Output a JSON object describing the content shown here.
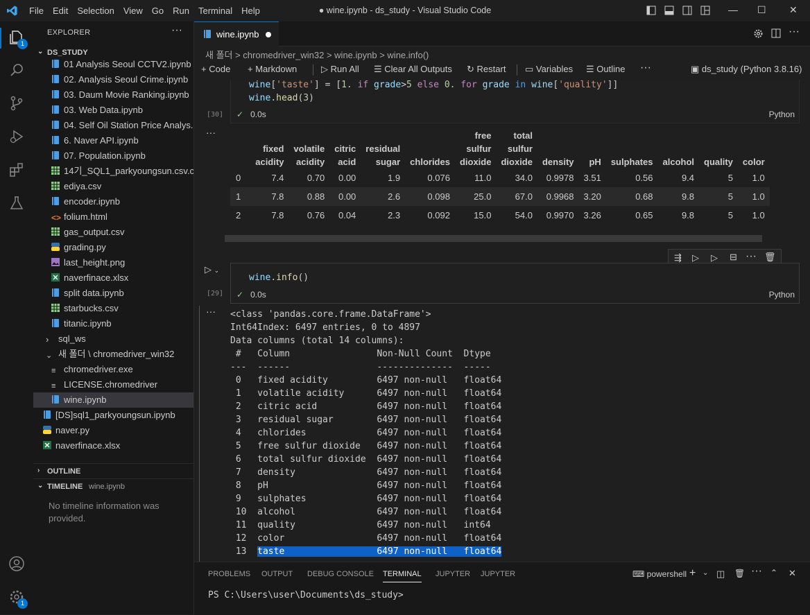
{
  "window": {
    "title": "● wine.ipynb - ds_study - Visual Studio Code",
    "menu": [
      "File",
      "Edit",
      "Selection",
      "View",
      "Go",
      "Run",
      "Terminal",
      "Help"
    ]
  },
  "activity": {
    "explorer_badge": "1",
    "settings_badge": "1"
  },
  "sidebar": {
    "header": "EXPLORER",
    "root": "DS_STUDY",
    "items": [
      {
        "label": "01 Analysis Seoul CCTV2.ipynb",
        "icon": "notebook-icon",
        "indent": 1
      },
      {
        "label": "02. Analysis Seoul Crime.ipynb",
        "icon": "notebook-icon",
        "indent": 1
      },
      {
        "label": "03. Daum Movie Ranking.ipynb",
        "icon": "notebook-icon",
        "indent": 1
      },
      {
        "label": "03. Web Data.ipynb",
        "icon": "notebook-icon",
        "indent": 1
      },
      {
        "label": "04. Self Oil Station Price Analys...",
        "icon": "notebook-icon",
        "indent": 1
      },
      {
        "label": "6. Naver API.ipynb",
        "icon": "notebook-icon",
        "indent": 1
      },
      {
        "label": "07. Population.ipynb",
        "icon": "notebook-icon",
        "indent": 1
      },
      {
        "label": "14기_SQL1_parkyoungsun.csv.c...",
        "icon": "csv-icon",
        "indent": 1
      },
      {
        "label": "ediya.csv",
        "icon": "csv-icon",
        "indent": 1
      },
      {
        "label": "encoder.ipynb",
        "icon": "notebook-icon",
        "indent": 1
      },
      {
        "label": "folium.html",
        "icon": "html-icon",
        "indent": 1
      },
      {
        "label": "gas_output.csv",
        "icon": "csv-icon",
        "indent": 1
      },
      {
        "label": "grading.py",
        "icon": "python-icon",
        "indent": 1
      },
      {
        "label": "last_height.png",
        "icon": "image-icon",
        "indent": 1
      },
      {
        "label": "naverfinace.xlsx",
        "icon": "excel-icon",
        "indent": 1
      },
      {
        "label": "split data.ipynb",
        "icon": "notebook-icon",
        "indent": 1
      },
      {
        "label": "starbucks.csv",
        "icon": "csv-icon",
        "indent": 1
      },
      {
        "label": "titanic.ipynb",
        "icon": "notebook-icon",
        "indent": 1
      },
      {
        "label": "sql_ws",
        "icon": "chevron-right-icon",
        "indent": 0
      },
      {
        "label": "새 폴더 \\ chromedriver_win32",
        "icon": "chevron-down-icon",
        "indent": 0
      },
      {
        "label": "chromedriver.exe",
        "icon": "file-lines-icon",
        "indent": 1
      },
      {
        "label": "LICENSE.chromedriver",
        "icon": "file-lines-icon",
        "indent": 1
      },
      {
        "label": "wine.ipynb",
        "icon": "notebook-icon",
        "indent": 1,
        "selected": true
      },
      {
        "label": "[DS]sql1_parkyoungsun.ipynb",
        "icon": "notebook-icon",
        "indent": -1
      },
      {
        "label": "naver.py",
        "icon": "python-icon",
        "indent": -1
      },
      {
        "label": "naverfinace.xlsx",
        "icon": "excel-icon",
        "indent": -1
      }
    ],
    "outline": "OUTLINE",
    "timeline": "TIMELINE",
    "timeline_file": "wine.ipynb",
    "timeline_empty": "No timeline information was provided."
  },
  "editor": {
    "tab": "wine.ipynb",
    "breadcrumb": "새 폴더 > chromedriver_win32 > wine.ipynb > wine.info()",
    "toolbar": {
      "code": "Code",
      "markdown": "Markdown",
      "run_all": "Run All",
      "clear": "Clear All Outputs",
      "restart": "Restart",
      "variables": "Variables",
      "outline": "Outline",
      "kernel": "ds_study (Python 3.8.16)"
    },
    "cell1": {
      "exec": "[30]",
      "time": "0.0s",
      "lang": "Python"
    },
    "cell2": {
      "exec": "[29]",
      "time": "0.0s",
      "lang": "Python"
    },
    "df_headers": [
      "",
      "fixed\nacidity",
      "volatile\nacidity",
      "citric\nacid",
      "residual\nsugar",
      "chlorides",
      "free\nsulfur\ndioxide",
      "total\nsulfur\ndioxide",
      "density",
      "pH",
      "sulphates",
      "alcohol",
      "quality",
      "color"
    ],
    "df_rows": [
      [
        "0",
        "7.4",
        "0.70",
        "0.00",
        "1.9",
        "0.076",
        "11.0",
        "34.0",
        "0.9978",
        "3.51",
        "0.56",
        "9.4",
        "5",
        "1.0"
      ],
      [
        "1",
        "7.8",
        "0.88",
        "0.00",
        "2.6",
        "0.098",
        "25.0",
        "67.0",
        "0.9968",
        "3.20",
        "0.68",
        "9.8",
        "5",
        "1.0"
      ],
      [
        "2",
        "7.8",
        "0.76",
        "0.04",
        "2.3",
        "0.092",
        "15.0",
        "54.0",
        "0.9970",
        "3.26",
        "0.65",
        "9.8",
        "5",
        "1.0"
      ]
    ],
    "info_lines": [
      "<class 'pandas.core.frame.DataFrame'>",
      "Int64Index: 6497 entries, 0 to 4897",
      "Data columns (total 14 columns):",
      " #   Column                Non-Null Count  Dtype  ",
      "---  ------                --------------  -----  ",
      " 0   fixed acidity         6497 non-null   float64",
      " 1   volatile acidity      6497 non-null   float64",
      " 2   citric acid           6497 non-null   float64",
      " 3   residual sugar        6497 non-null   float64",
      " 4   chlorides             6497 non-null   float64",
      " 5   free sulfur dioxide   6497 non-null   float64",
      " 6   total sulfur dioxide  6497 non-null   float64",
      " 7   density               6497 non-null   float64",
      " 8   pH                    6497 non-null   float64",
      " 9   sulphates             6497 non-null   float64",
      " 10  alcohol               6497 non-null   float64",
      " 11  quality               6497 non-null   int64  ",
      " 12  color                 6497 non-null   float64"
    ],
    "info_last": {
      "num": " 13",
      "name": "taste",
      "count": "6497 non-null",
      "dtype": "float64"
    }
  },
  "panel": {
    "tabs": [
      "PROBLEMS",
      "OUTPUT",
      "DEBUG CONSOLE",
      "TERMINAL",
      "JUPYTER",
      "JUPYTER"
    ],
    "active": "TERMINAL",
    "shell": "powershell",
    "prompt": "PS C:\\Users\\user\\Documents\\ds_study>"
  }
}
